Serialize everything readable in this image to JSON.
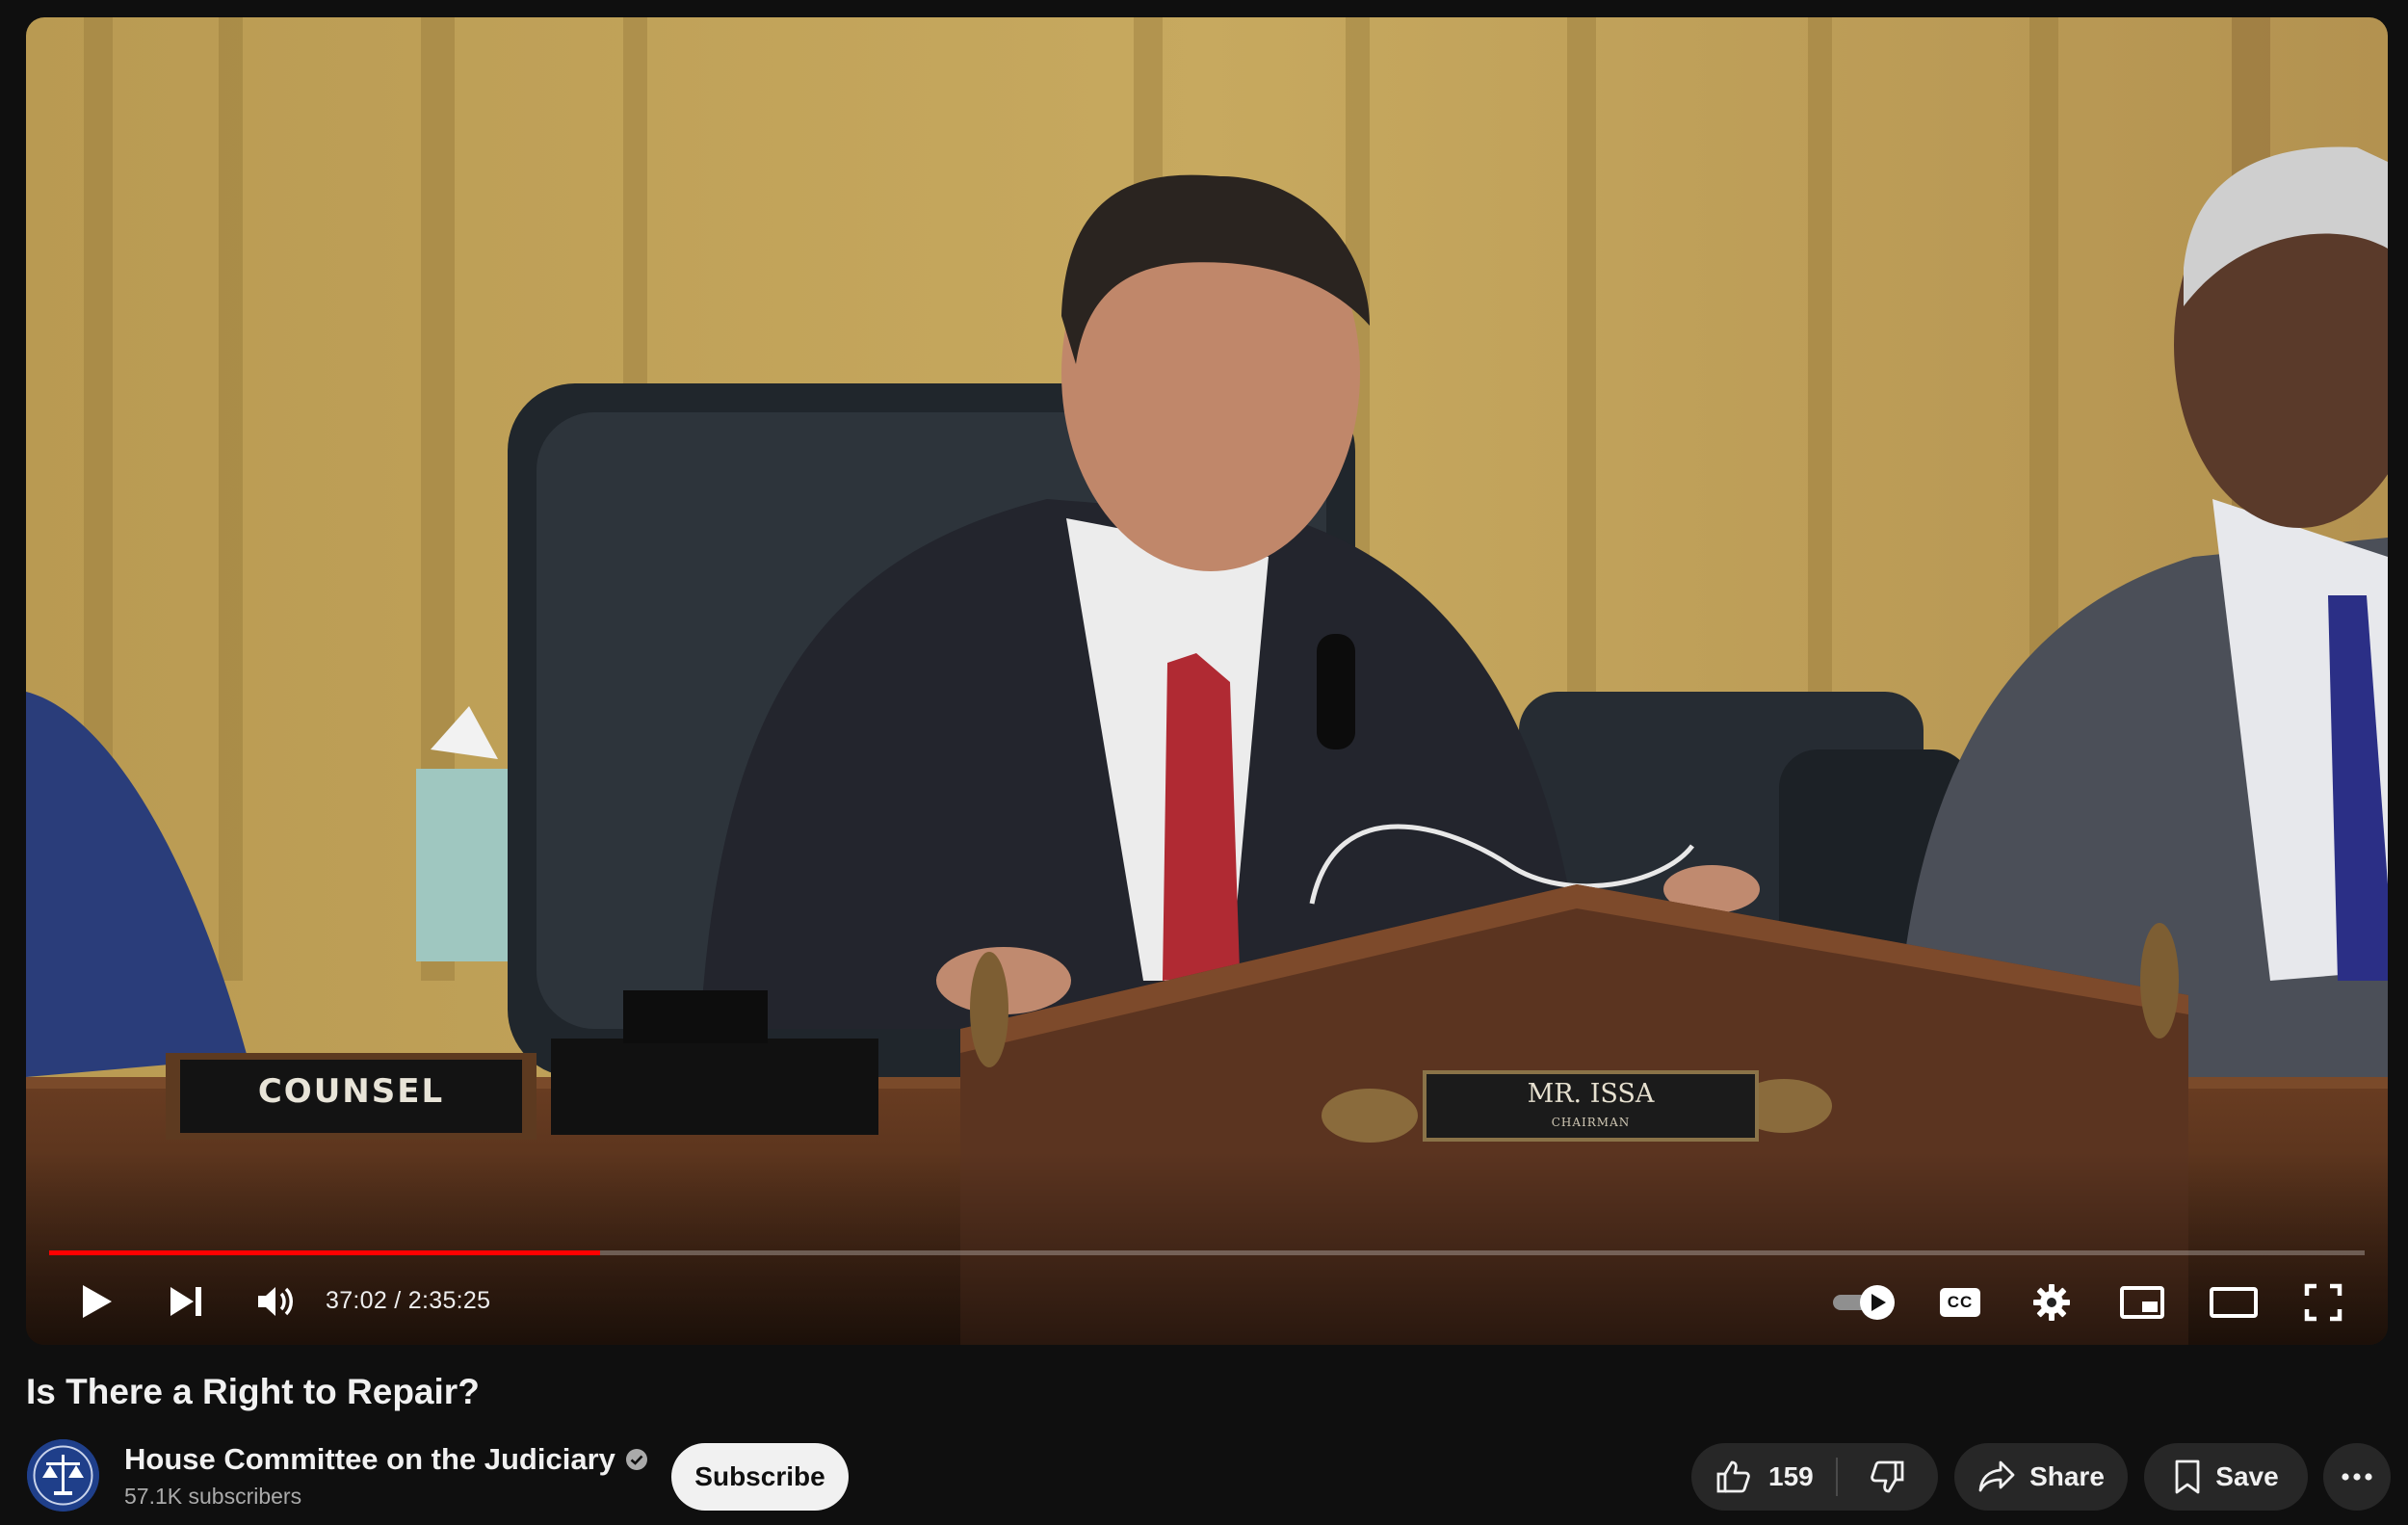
{
  "video": {
    "current_time": "37:02",
    "duration": "2:35:25",
    "time_display": "37:02 / 2:35:25",
    "progress_fraction": 0.238,
    "nameplate_left": "COUNSEL",
    "nameplate_center": "MR. ISSA",
    "nameplate_center_sub": "CHAIRMAN"
  },
  "controls": {
    "cc_label": "CC"
  },
  "title": "Is There a Right to Repair?",
  "channel": {
    "name": "House Committee on the Judiciary",
    "subscribers": "57.1K subscribers",
    "verified": true
  },
  "actions": {
    "subscribe_label": "Subscribe",
    "like_count": "159",
    "share_label": "Share",
    "save_label": "Save"
  },
  "colors": {
    "background": "#0f0f0f",
    "progress": "#ff0000",
    "pill": "#272727",
    "subscribe_bg": "#f1f1f1"
  }
}
